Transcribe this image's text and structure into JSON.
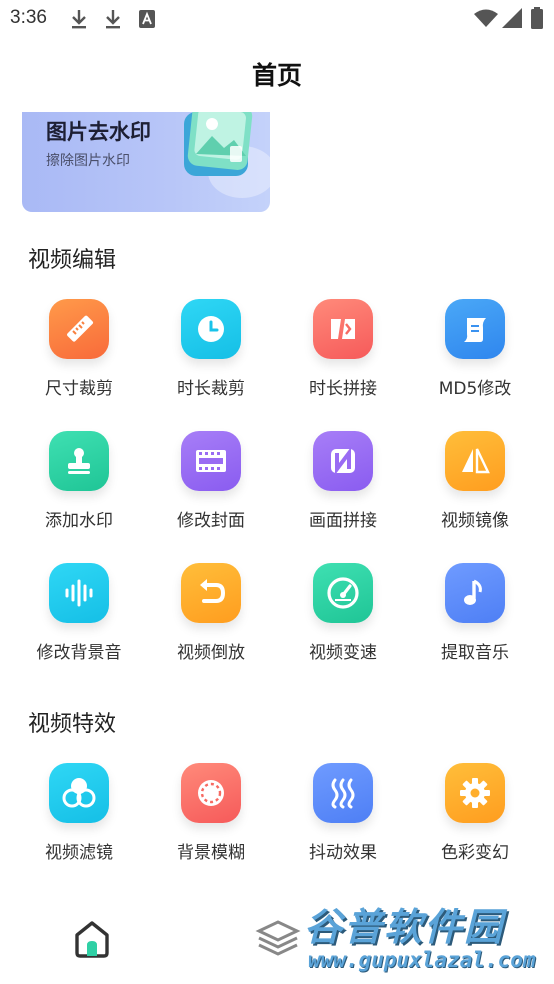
{
  "status_bar": {
    "time": "3:36",
    "left_icons": [
      "download-icon",
      "download-icon",
      "keyboard-a-icon"
    ],
    "right_icons": [
      "wifi-icon",
      "signal-icon",
      "battery-icon"
    ]
  },
  "header": {
    "title": "首页"
  },
  "banner": {
    "title": "图片去水印",
    "subtitle": "擦除图片水印"
  },
  "video_edit": {
    "title": "视频编辑",
    "tools": [
      {
        "label": "尺寸裁剪",
        "icon": "ruler-icon",
        "color_from": "#ff9a4a",
        "color_to": "#f86a3a"
      },
      {
        "label": "时长裁剪",
        "icon": "clock-icon",
        "color_from": "#2fd7f5",
        "color_to": "#15bfe6"
      },
      {
        "label": "时长拼接",
        "icon": "splice-icon",
        "color_from": "#ff8a7a",
        "color_to": "#f65a5a"
      },
      {
        "label": "MD5修改",
        "icon": "document-icon",
        "color_from": "#4aa8f7",
        "color_to": "#2f86ee"
      },
      {
        "label": "添加水印",
        "icon": "stamp-icon",
        "color_from": "#3fe0b2",
        "color_to": "#1fc596"
      },
      {
        "label": "修改封面",
        "icon": "film-icon",
        "color_from": "#a77ef7",
        "color_to": "#8a5cf0"
      },
      {
        "label": "画面拼接",
        "icon": "panel-icon",
        "color_from": "#a77ef7",
        "color_to": "#8a5cf0"
      },
      {
        "label": "视频镜像",
        "icon": "mirror-icon",
        "color_from": "#ffbe3a",
        "color_to": "#ff9d1f"
      },
      {
        "label": "修改背景音",
        "icon": "waveform-icon",
        "color_from": "#2fd7f5",
        "color_to": "#15bfe6"
      },
      {
        "label": "视频倒放",
        "icon": "rewind-icon",
        "color_from": "#ffbe3a",
        "color_to": "#ff9d1f"
      },
      {
        "label": "视频变速",
        "icon": "speedometer-icon",
        "color_from": "#3fe0b2",
        "color_to": "#1fc596"
      },
      {
        "label": "提取音乐",
        "icon": "music-note-icon",
        "color_from": "#6f9bff",
        "color_to": "#4e7ff5"
      }
    ]
  },
  "video_effects": {
    "title": "视频特效",
    "tools": [
      {
        "label": "视频滤镜",
        "icon": "filter-circles-icon",
        "color_from": "#2fd7f5",
        "color_to": "#15bfe6"
      },
      {
        "label": "背景模糊",
        "icon": "blur-circle-icon",
        "color_from": "#ff8a7a",
        "color_to": "#f65a5a"
      },
      {
        "label": "抖动效果",
        "icon": "wave-lines-icon",
        "color_from": "#6f9bff",
        "color_to": "#4e7ff5"
      },
      {
        "label": "色彩变幻",
        "icon": "gear-icon",
        "color_from": "#ffbe3a",
        "color_to": "#ff9d1f"
      }
    ]
  },
  "bottom_nav": {
    "tabs": [
      {
        "icon": "home-icon",
        "active": true
      },
      {
        "icon": "layers-icon",
        "active": false
      }
    ]
  },
  "watermark": {
    "title": "谷普软件园",
    "url": "www.gupuxlazal.com"
  }
}
